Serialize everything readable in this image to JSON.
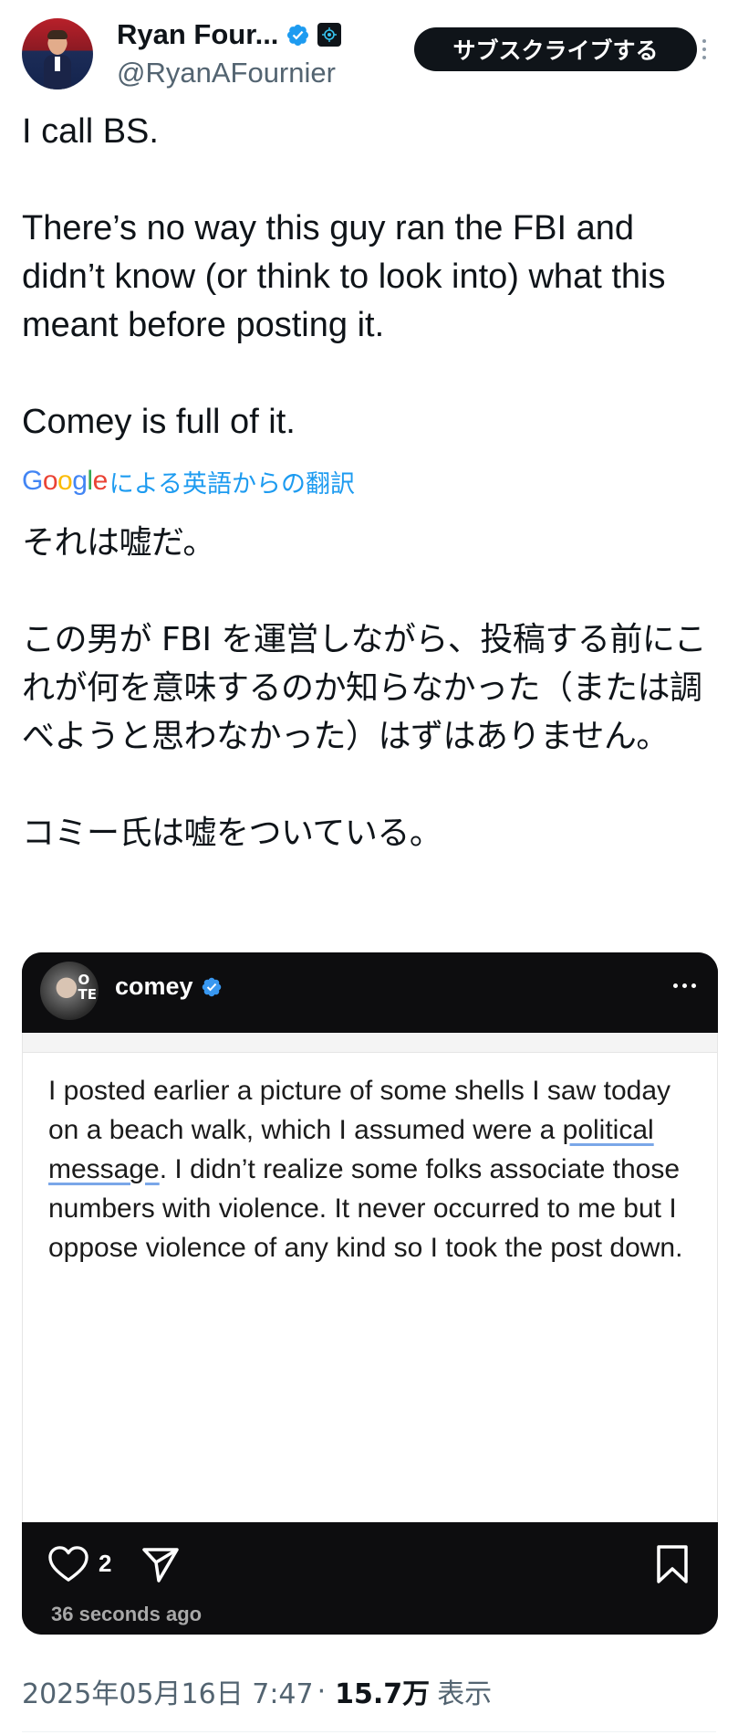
{
  "author": {
    "display_name": "Ryan Four...",
    "handle": "@RyanAFournier",
    "verified": true
  },
  "subscribe_label": "サブスクライブする",
  "post": {
    "lines": [
      "I call BS.",
      "There’s no way this guy ran the FBI and didn’t know (or think to look into) what this meant before posting it.",
      "Comey is full of it."
    ]
  },
  "translation": {
    "google_label": "Google",
    "label": "による英語からの翻訳",
    "lines": [
      "それは嘘だ。",
      "この男が FBI を運営しながら、投稿する前にこれが何を意味するのか知らなかった（または調べようと思わなかった）はずはありません。",
      "コミー氏は嘘をついている。"
    ]
  },
  "embedded": {
    "username": "comey",
    "avatar_text": "O\nTE",
    "message_before": "I posted earlier a picture of some shells I saw today on a beach walk, which I assumed were a ",
    "message_ul1": "political",
    "message_ul2": "message",
    "message_after": ". I didn’t realize some folks associate those numbers with violence. It never occurred to me but I oppose violence of any kind so I took the post down.",
    "like_count": "2",
    "time_ago": "36 seconds ago"
  },
  "meta": {
    "datetime": "2025年05月16日 7:47",
    "separator": "·",
    "views": "15.7万",
    "views_label": "表示"
  },
  "colors": {
    "text": "#0f1419",
    "secondary": "#536471",
    "link": "#1d9bf0",
    "verified": "#1d9bf0"
  }
}
